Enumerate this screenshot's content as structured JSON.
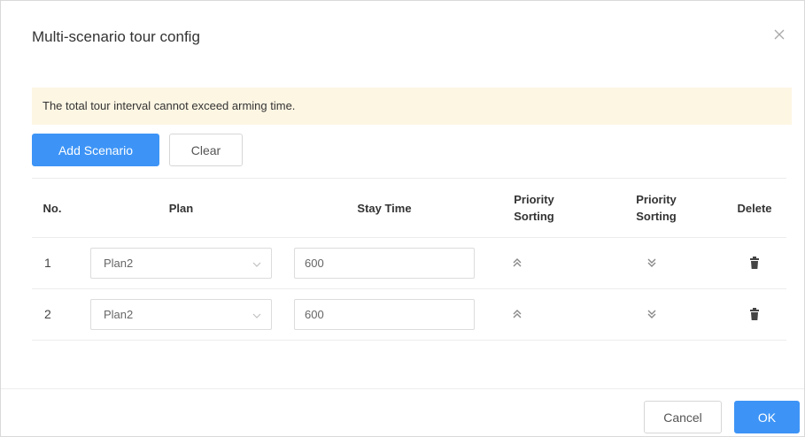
{
  "dialog": {
    "title": "Multi-scenario tour config"
  },
  "alert": {
    "text": "The total tour interval cannot exceed arming time."
  },
  "toolbar": {
    "add_label": "Add Scenario",
    "clear_label": "Clear"
  },
  "table": {
    "columns": {
      "no": "No.",
      "plan": "Plan",
      "stay_time": "Stay Time",
      "priority_up": "Priority Sorting",
      "priority_down": "Priority Sorting",
      "delete": "Delete"
    },
    "rows": [
      {
        "no": "1",
        "plan": "Plan2",
        "stay_time": "600"
      },
      {
        "no": "2",
        "plan": "Plan2",
        "stay_time": "600"
      }
    ]
  },
  "footer": {
    "cancel_label": "Cancel",
    "ok_label": "OK"
  },
  "colors": {
    "primary": "#3d94f6",
    "alert_bg": "#fdf6e3"
  }
}
